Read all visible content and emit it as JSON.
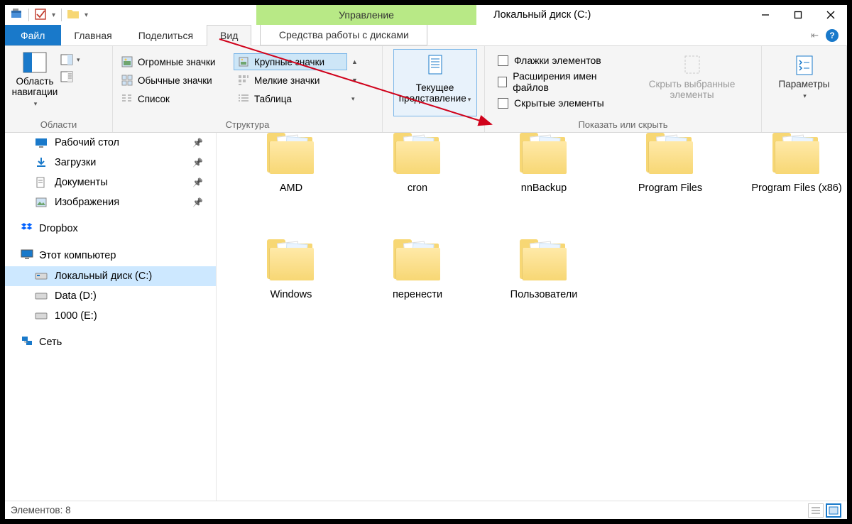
{
  "titlebar": {
    "context_tab": "Управление",
    "title": "Локальный диск (C:)"
  },
  "tabs": {
    "file": "Файл",
    "home": "Главная",
    "share": "Поделиться",
    "view": "Вид",
    "drive_tools": "Средства работы с дисками"
  },
  "ribbon": {
    "panes_group": "Области",
    "nav_pane": "Область навигации",
    "layout_group": "Структура",
    "layout": {
      "extra_large": "Огромные значки",
      "large": "Крупные значки",
      "medium": "Обычные значки",
      "small": "Мелкие значки",
      "list": "Список",
      "table": "Таблица"
    },
    "current_view": "Текущее представление",
    "show_hide_group": "Показать или скрыть",
    "checks": {
      "item_checkboxes": "Флажки элементов",
      "file_ext": "Расширения имен файлов",
      "hidden": "Скрытые элементы"
    },
    "hide_selected": "Скрыть выбранные элементы",
    "options": "Параметры"
  },
  "sidebar": {
    "desktop": "Рабочий стол",
    "downloads": "Загрузки",
    "documents": "Документы",
    "pictures": "Изображения",
    "dropbox": "Dropbox",
    "this_pc": "Этот компьютер",
    "local_c": "Локальный диск (C:)",
    "data_d": "Data (D:)",
    "e1000": "1000 (E:)",
    "network": "Сеть"
  },
  "folders": [
    "AMD",
    "cron",
    "nnBackup",
    "Program Files",
    "Program Files (x86)",
    "Windows",
    "перенести",
    "Пользователи"
  ],
  "status": {
    "items": "Элементов: 8"
  }
}
